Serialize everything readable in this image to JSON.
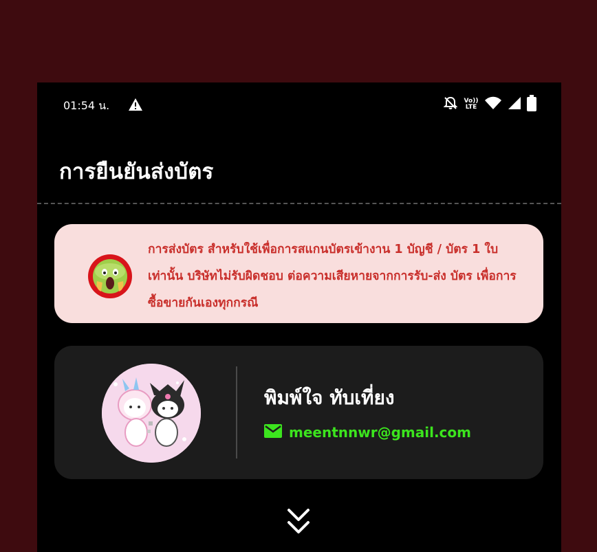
{
  "status_bar": {
    "time": "01:54 น.",
    "volte_label_top": "Vo))",
    "volte_label_bottom": "LTE",
    "icons": [
      "warning-icon",
      "bell-off-icon",
      "volte-icon",
      "wifi-icon",
      "signal-icon",
      "battery-icon"
    ]
  },
  "header": {
    "title": "การยืนยันส่งบัตร"
  },
  "notice": {
    "emoji": "scream-emoji-icon",
    "text": "การส่งบัตร สำหรับใช้เพื่อการสแกนบัตรเข้างาน 1 บัญชี / บัตร 1 ใบเท่านั้น บริษัทไม่รับผิดชอบ ต่อความเสียหายจากการรับ-ส่ง บัตร เพื่อการซื้อขายกันเองทุกกรณี"
  },
  "profile": {
    "name": "พิมพ์ใจ ทับเที่ยง",
    "email": "meentnnwr@gmail.com"
  },
  "expand": {
    "icon": "chevrons-down-icon"
  },
  "colors": {
    "backdrop": "#3e0b0f",
    "screen_bg": "#000000",
    "notice_bg": "#f9dedd",
    "notice_text": "#c9302c",
    "card_bg": "#1c1c1c",
    "email_green": "#3ce41e"
  }
}
